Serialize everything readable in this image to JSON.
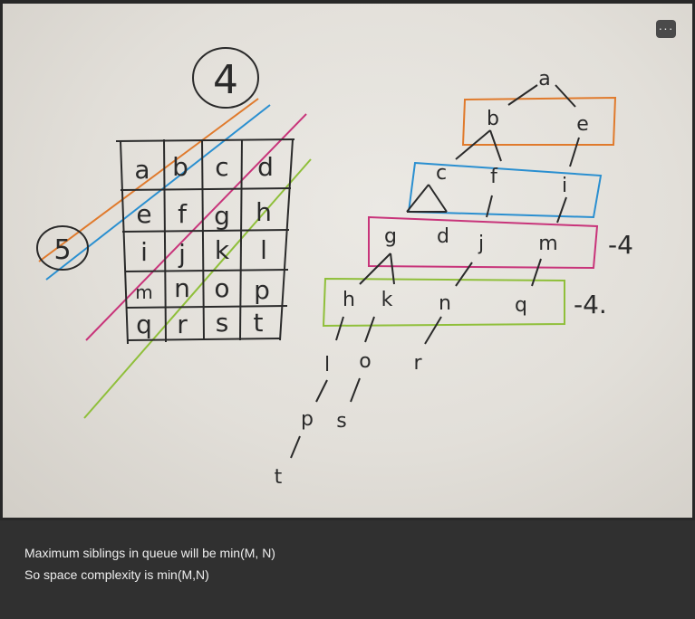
{
  "toolbar": {
    "more_label": "···",
    "more_icon": "more-horizontal-icon"
  },
  "photo": {
    "grid_rows": [
      [
        "a",
        "b",
        "c",
        "d"
      ],
      [
        "e",
        "f",
        "g",
        "h"
      ],
      [
        "i",
        "j",
        "k",
        "l"
      ],
      [
        "m",
        "n",
        "o",
        "p"
      ],
      [
        "q",
        "r",
        "s",
        "t"
      ]
    ],
    "circle_top": "4",
    "circle_left": "5",
    "tree": {
      "root": "a",
      "level1": [
        "b",
        "e"
      ],
      "level2": [
        "c",
        "f",
        "i"
      ],
      "level3": [
        "g",
        "d",
        "j",
        "m"
      ],
      "level4": [
        "h",
        "k",
        "n",
        "q"
      ],
      "level5": [
        "l",
        "o",
        "r"
      ],
      "level6": [
        "p",
        "s"
      ],
      "level7": [
        "t"
      ],
      "note_level3": "-4",
      "note_level4": "-4."
    },
    "colors": {
      "orange": "#e07a2c",
      "blue": "#2a8fd0",
      "magenta": "#c8347a",
      "green": "#8fbf3a",
      "ink": "#2a2a2a"
    }
  },
  "caption": {
    "line1": "Maximum siblings in queue will be min(M, N)",
    "line2": "So space complexity is min(M,N)"
  }
}
